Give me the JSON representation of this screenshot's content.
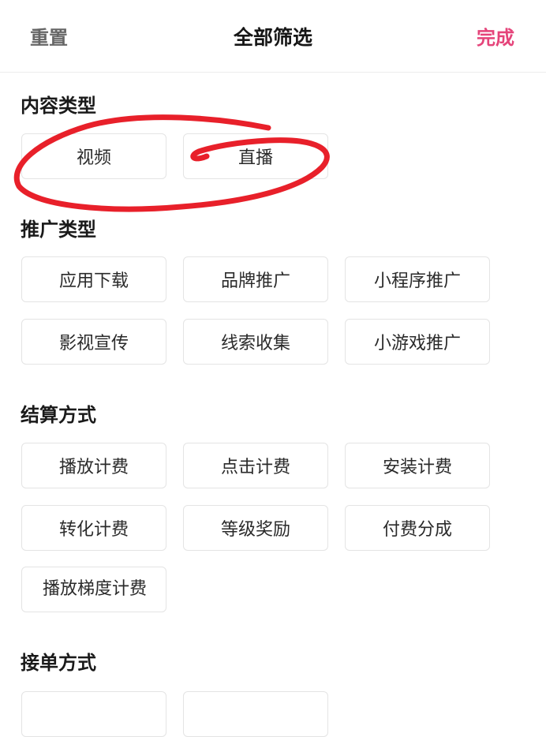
{
  "header": {
    "reset_label": "重置",
    "title": "全部筛选",
    "done_label": "完成",
    "done_color": "#e5447a"
  },
  "sections": {
    "content_type": {
      "title": "内容类型",
      "options": [
        "视频",
        "直播"
      ]
    },
    "promotion_type": {
      "title": "推广类型",
      "options": [
        "应用下载",
        "品牌推广",
        "小程序推广",
        "影视宣传",
        "线索收集",
        "小游戏推广"
      ]
    },
    "settlement": {
      "title": "结算方式",
      "options": [
        "播放计费",
        "点击计费",
        "安装计费",
        "转化计费",
        "等级奖励",
        "付费分成",
        "播放梯度计费"
      ]
    },
    "order_method": {
      "title": "接单方式"
    }
  },
  "annotation_color": "#e8202a"
}
